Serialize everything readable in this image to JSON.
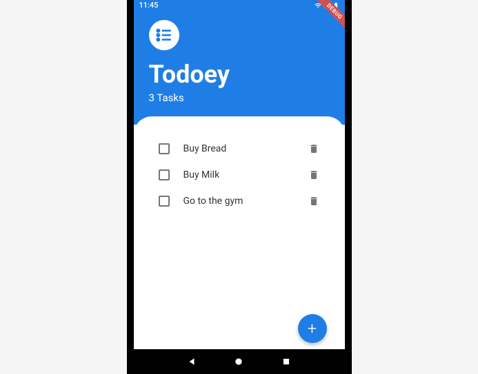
{
  "status": {
    "time": "11:45",
    "debug_label": "DEBUG"
  },
  "header": {
    "title": "Todoey",
    "task_count": "3 Tasks"
  },
  "tasks": [
    {
      "label": "Buy Bread",
      "checked": false
    },
    {
      "label": "Buy Milk",
      "checked": false
    },
    {
      "label": "Go to the gym",
      "checked": false
    }
  ],
  "fab": {
    "label": "+"
  },
  "colors": {
    "primary": "#1f7ee6",
    "debug_banner": "#d05050"
  }
}
